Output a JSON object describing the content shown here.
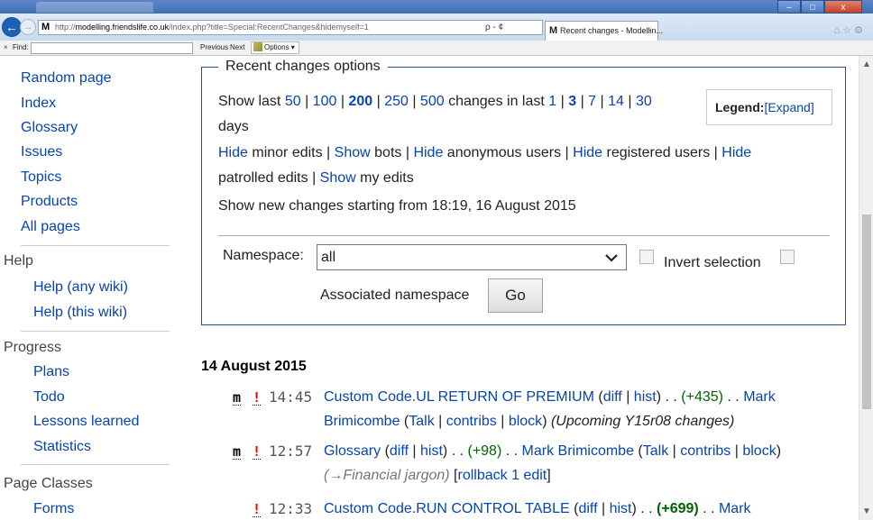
{
  "browser": {
    "address": "http://modelling.friendslife.co.uk/index.php?title=Special:RecentChanges&hidemyself=1",
    "address_host": "modelling.friendslife.co.uk",
    "address_rest": "/index.php?title=Special:RecentChanges&hidemyself=1",
    "addr_controls": "ρ - ¢",
    "tab_title": "Recent changes - Modellin...",
    "tab_favicon": "M",
    "window_controls": [
      "–",
      "□",
      "x"
    ]
  },
  "findbar": {
    "label": "Find:",
    "value": "",
    "previous": "Previous",
    "next": "Next",
    "options": "Options ▾"
  },
  "sidebar": {
    "nav": [
      {
        "label": "Random page"
      },
      {
        "label": "Index"
      },
      {
        "label": "Glossary"
      },
      {
        "label": "Issues"
      },
      {
        "label": "Topics"
      },
      {
        "label": "Products"
      },
      {
        "label": "All pages"
      }
    ],
    "help": {
      "heading": "Help",
      "items": [
        {
          "label": "Help (any wiki)"
        },
        {
          "label": "Help (this wiki)"
        }
      ]
    },
    "progress": {
      "heading": "Progress",
      "items": [
        {
          "label": "Plans"
        },
        {
          "label": "Todo"
        },
        {
          "label": "Lessons learned"
        },
        {
          "label": "Statistics"
        }
      ]
    },
    "page_classes": {
      "heading": "Page Classes",
      "items": [
        {
          "label": "Forms"
        }
      ]
    }
  },
  "rc_options": {
    "legend": "Recent changes options",
    "show_last": "Show last",
    "limits": [
      "50",
      "100",
      "200",
      "250",
      "500"
    ],
    "limit_selected": "200",
    "changes_in_last": "changes in last",
    "days_options": [
      "1",
      "3",
      "7",
      "14",
      "30"
    ],
    "days_selected": "3",
    "days_word": "days",
    "legend_label": "Legend:",
    "legend_expand": "[Expand]",
    "filters_line1": [
      {
        "action": "Hide",
        "text": "minor edits"
      },
      {
        "action": "Show",
        "text": "bots"
      },
      {
        "action": "Hide",
        "text": "anonymous users"
      },
      {
        "action": "Hide",
        "text": "registered users"
      },
      {
        "action": "Hide",
        "text": ""
      }
    ],
    "filters_line2": [
      {
        "action": "",
        "text": "patrolled edits"
      },
      {
        "action": "Show",
        "text": "my edits"
      }
    ],
    "new_changes": "Show new changes starting from 18:19, 16 August 2015",
    "namespace_label": "Namespace:",
    "namespace_value": "all",
    "invert_label": "Invert selection",
    "associated_label": "Associated namespace",
    "go_label": "Go"
  },
  "changes": {
    "date": "14 August 2015",
    "entries": [
      {
        "minor": "m",
        "unpatrolled": "!",
        "time": "14:45",
        "title": "Custom Code.UL RETURN OF PREMIUM",
        "diff": "diff",
        "hist": "hist",
        "size": "(+435)",
        "user": "Mark",
        "user2": "Brimicombe",
        "talk": "Talk",
        "contribs": "contribs",
        "block": "block",
        "summary": "(Upcoming Y15r08 changes)"
      },
      {
        "minor": "m",
        "unpatrolled": "!",
        "time": "12:57",
        "title": "Glossary",
        "diff": "diff",
        "hist": "hist",
        "size": "(+98)",
        "user": "Mark Brimicombe",
        "talk": "Talk",
        "contribs": "contribs",
        "block": "block",
        "summary": "(→Financial jargon)",
        "rollback": "rollback 1 edit"
      },
      {
        "minor": "",
        "unpatrolled": "!",
        "time": "12:33",
        "title": "Custom Code.RUN CONTROL TABLE",
        "diff": "diff",
        "hist": "hist",
        "size": "(+699)",
        "user": "Mark"
      }
    ]
  },
  "colors": {
    "link": "#0645ad",
    "positive_size": "#006400",
    "unpatrolled": "#ee0000",
    "box_border": "#2a4b8d"
  }
}
